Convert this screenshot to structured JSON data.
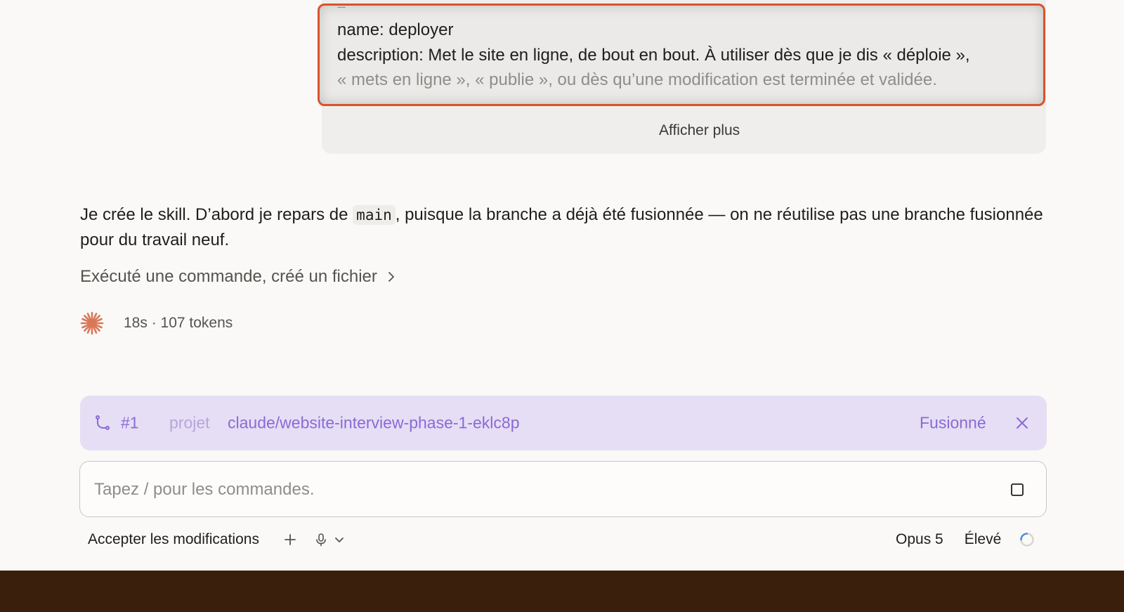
{
  "skill_file": {
    "dashes": "---",
    "line1": "name: deployer",
    "line2": "description: Met le site en ligne, de bout en bout. À utiliser dès que je dis « déploie »,",
    "line3": "« mets en ligne », « publie », ou dès qu’une modification est terminée et validée.",
    "show_more": "Afficher plus",
    "highlight_color": "#d9532a"
  },
  "assistant": {
    "text_before_code": "Je crée le skill. D’abord je repars de ",
    "code": "main",
    "text_after_code": ", puisque la branche a déjà été fusionnée — on ne réutilise pas une branche fusionnée pour du travail neuf.",
    "tool_summary": "Exécuté une commande, créé un fichier",
    "status": "18s · 107 tokens",
    "status_icon": "sparkle-icon",
    "accent_color": "#d97757"
  },
  "pr_bar": {
    "icon": "branch-icon",
    "number": "#1",
    "repo": "projet",
    "branch": "claude/website-interview-phase-1-eklc8p",
    "status": "Fusionné",
    "bg_color": "#e6def5",
    "text_color": "#8a6ad6"
  },
  "composer": {
    "placeholder": "Tapez / pour les commandes.",
    "value": ""
  },
  "toolbar": {
    "accept_label": "Accepter les modifications",
    "model": "Opus 5",
    "effort": "Élevé"
  }
}
